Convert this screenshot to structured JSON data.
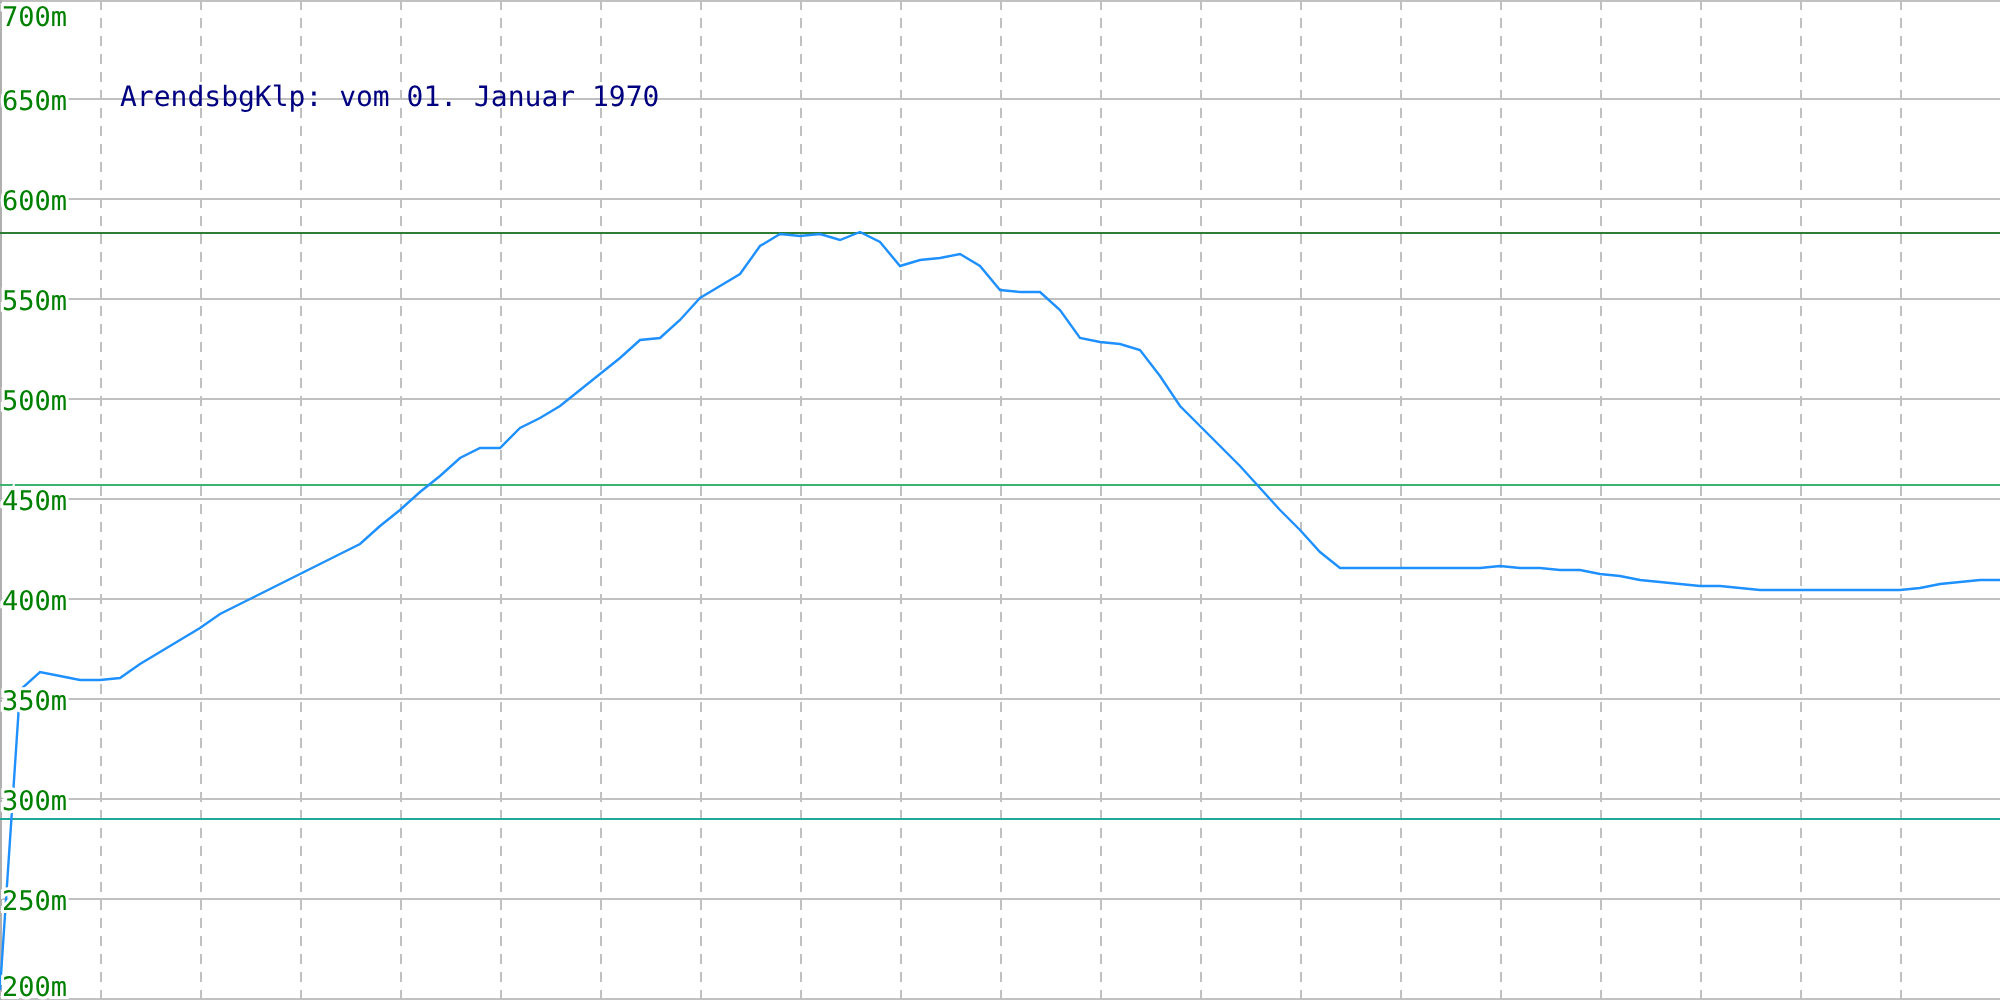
{
  "chart": {
    "chart_data": {
      "type": "line",
      "title": "ArendsbgKlp: vom 01. Januar 1970",
      "ylim": [
        200,
        700
      ],
      "yticks": [
        {
          "value": 200,
          "label": "200m"
        },
        {
          "value": 250,
          "label": "250m"
        },
        {
          "value": 300,
          "label": "300m"
        },
        {
          "value": 350,
          "label": "350m"
        },
        {
          "value": 400,
          "label": "400m"
        },
        {
          "value": 450,
          "label": "450m"
        },
        {
          "value": 500,
          "label": "500m"
        },
        {
          "value": 550,
          "label": "550m"
        },
        {
          "value": 600,
          "label": "600m"
        },
        {
          "value": 650,
          "label": "650m"
        },
        {
          "value": 700,
          "label": "700m"
        }
      ],
      "categories": [
        null,
        null,
        null,
        null,
        null,
        null,
        null,
        null,
        null,
        null,
        null,
        null,
        null,
        null,
        null,
        null,
        null,
        null,
        null,
        null,
        null,
        null,
        null,
        null,
        null,
        null,
        null,
        null,
        null,
        null,
        null,
        null,
        null,
        null,
        null,
        null,
        null,
        null,
        null,
        null,
        null,
        null,
        null,
        null,
        null,
        null,
        null,
        null,
        null,
        null,
        null,
        null,
        null,
        null,
        null,
        null,
        null,
        null,
        null,
        null,
        null,
        null,
        null,
        null,
        null,
        null,
        null,
        null,
        null,
        null,
        null,
        null,
        null,
        null,
        null,
        null,
        null,
        null,
        null,
        null,
        null,
        null,
        null,
        null,
        null,
        null,
        null,
        null,
        null,
        null,
        null,
        null,
        null,
        null,
        null,
        null,
        null,
        null,
        null,
        null,
        null
      ],
      "series": [
        {
          "color": "#1e90ff",
          "values": [
            205,
            355,
            364,
            362,
            360,
            360,
            361,
            368,
            374,
            380,
            386,
            393,
            398,
            403,
            408,
            413,
            418,
            423,
            428,
            437,
            445,
            454,
            462,
            471,
            476,
            476,
            486,
            491,
            497,
            505,
            513,
            521,
            530,
            531,
            540,
            551,
            557,
            563,
            577,
            583,
            582,
            583,
            580,
            584,
            579,
            567,
            570,
            571,
            573,
            567,
            555,
            554,
            554,
            545,
            531,
            529,
            528,
            525,
            512,
            497,
            487,
            477,
            467,
            456,
            445,
            435,
            424,
            416,
            416,
            416,
            416,
            416,
            416,
            416,
            416,
            417,
            416,
            416,
            415,
            415,
            413,
            412,
            410,
            409,
            408,
            407,
            407,
            406,
            405,
            405,
            405,
            405,
            405,
            405,
            405,
            405,
            406,
            408,
            409,
            410,
            410
          ]
        }
      ],
      "ref_lines": [
        {
          "axis": "y",
          "value": 584,
          "color": "#2e7d32"
        },
        {
          "axis": "y",
          "value": 458,
          "color": "#3cb371"
        },
        {
          "axis": "y",
          "value": 291,
          "color": "#20a89a"
        }
      ],
      "grid": true
    }
  }
}
